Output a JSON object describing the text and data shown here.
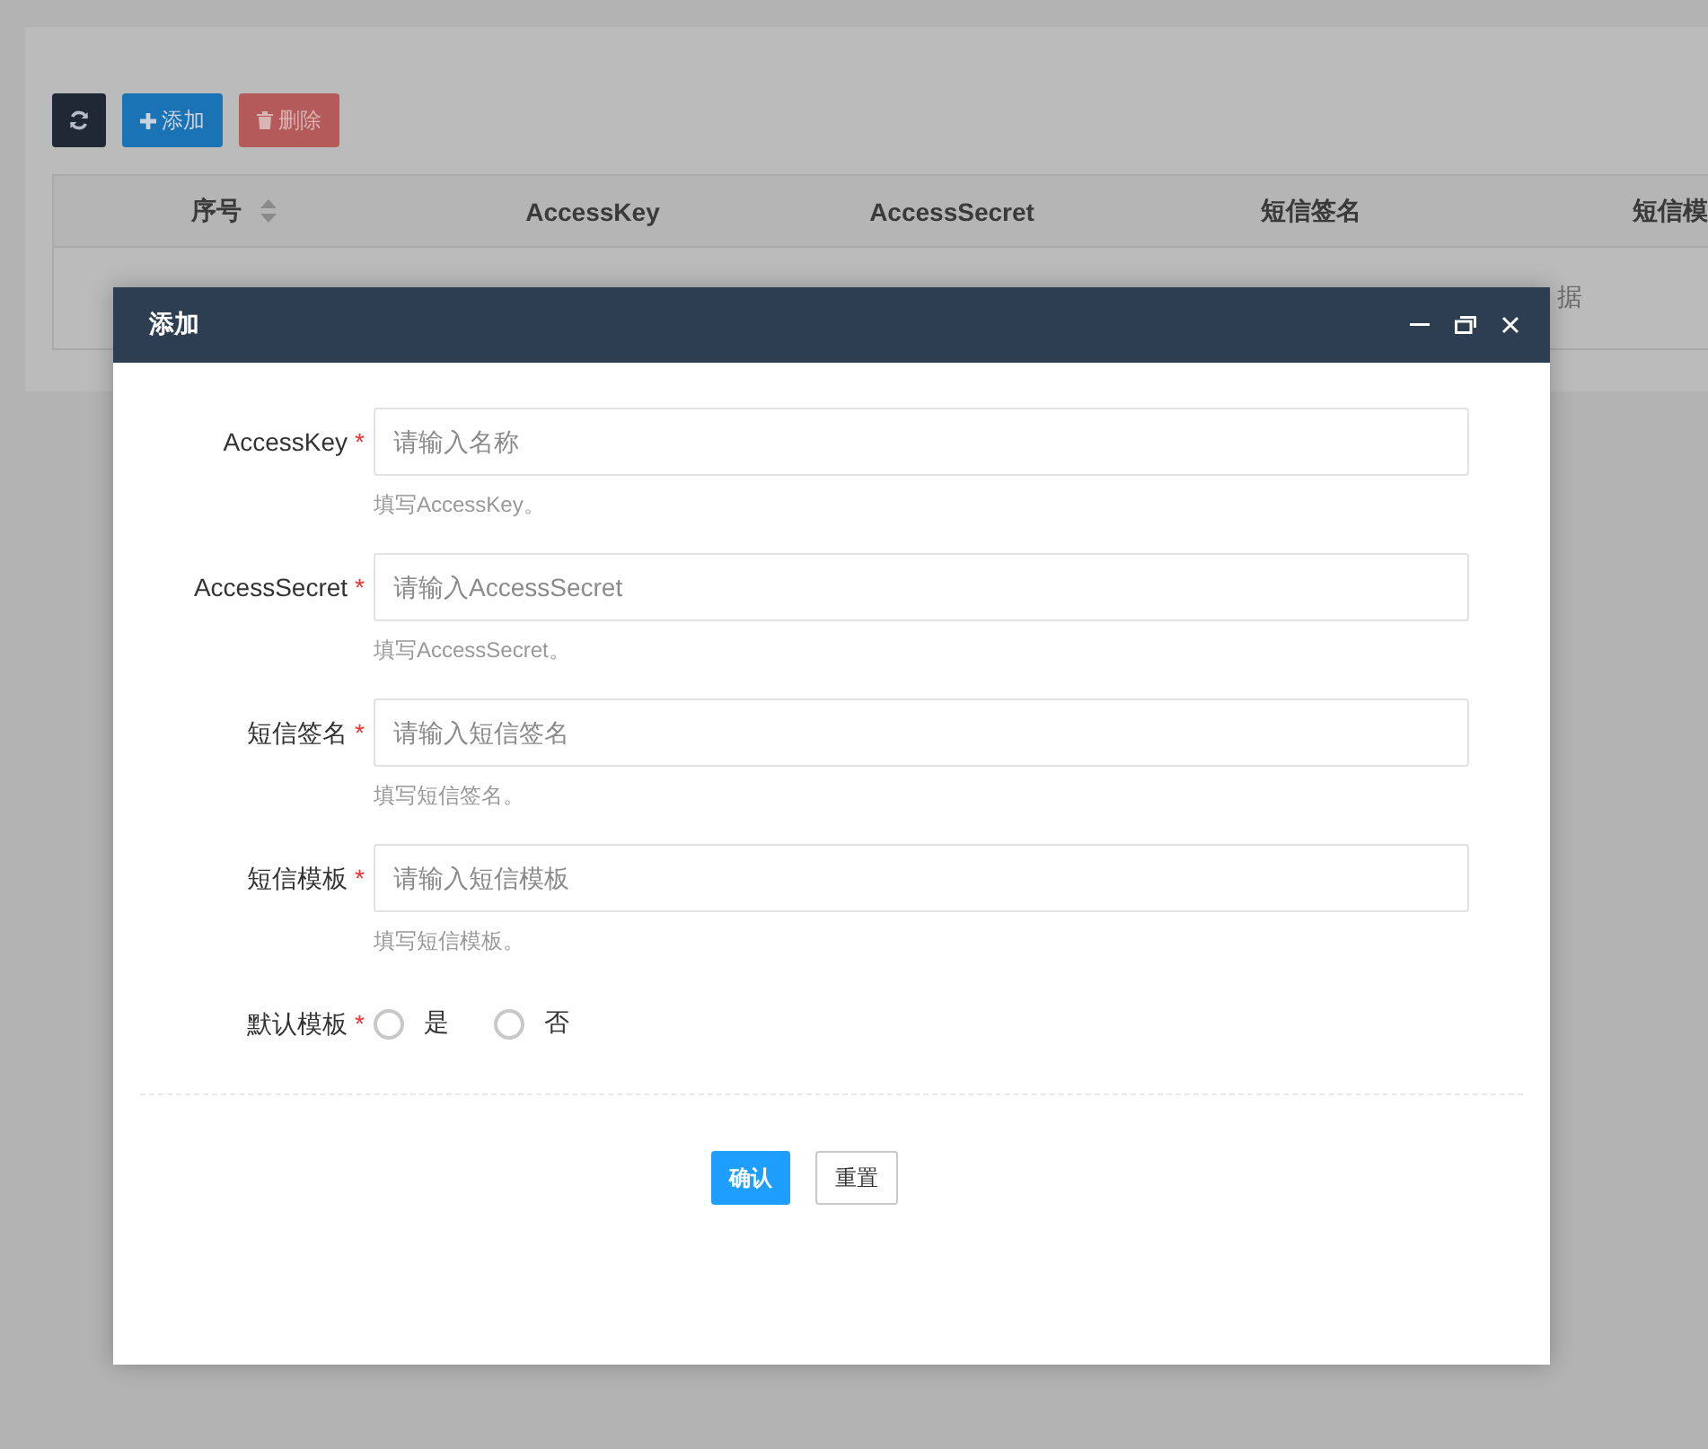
{
  "toolbar": {
    "buttons": [
      {
        "kind": "refresh"
      },
      {
        "kind": "add",
        "label": "添加"
      },
      {
        "kind": "delete",
        "label": "删除"
      }
    ]
  },
  "table": {
    "columns": [
      {
        "label": "序号",
        "sortable": true
      },
      {
        "label": "AccessKey",
        "sortable": false
      },
      {
        "label": "AccessSecret",
        "sortable": false
      },
      {
        "label": "短信签名",
        "sortable": false
      },
      {
        "label": "短信模",
        "sortable": false
      }
    ],
    "empty_text": "据"
  },
  "dialog": {
    "title": "添加",
    "fields": [
      {
        "kind": "text",
        "label": "AccessKey",
        "required_mark": "*",
        "placeholder": "请输入名称",
        "help": "填写AccessKey。"
      },
      {
        "kind": "text",
        "label": "AccessSecret",
        "required_mark": "*",
        "placeholder": "请输入AccessSecret",
        "help": "填写AccessSecret。"
      },
      {
        "kind": "text",
        "label": "短信签名",
        "required_mark": "*",
        "placeholder": "请输入短信签名",
        "help": "填写短信签名。"
      },
      {
        "kind": "text",
        "label": "短信模板",
        "required_mark": "*",
        "placeholder": "请输入短信模板",
        "help": "填写短信模板。"
      },
      {
        "kind": "radio",
        "label": "默认模板",
        "required_mark": "*",
        "options": [
          {
            "label": "是",
            "selected": false
          },
          {
            "label": "否",
            "selected": false
          }
        ]
      }
    ],
    "buttons": [
      {
        "kind": "primary",
        "label": "确认"
      },
      {
        "kind": "default",
        "label": "重置"
      }
    ]
  }
}
